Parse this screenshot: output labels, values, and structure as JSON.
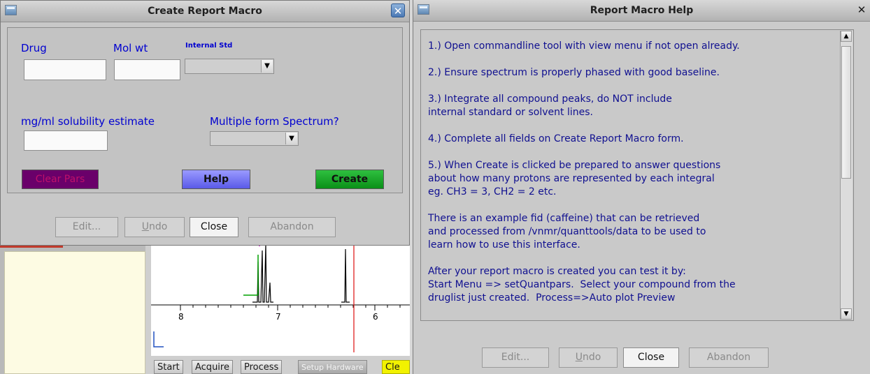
{
  "dialog1": {
    "title": "Create Report Macro",
    "close_glyph": "✕",
    "labels": {
      "drug": "Drug",
      "mol_wt": "Mol wt",
      "internal_std": "Internal Std",
      "solubility": "mg/ml solubility estimate",
      "multiple_form": "Multiple form Spectrum?"
    },
    "fields": {
      "drug_value": "",
      "mol_wt_value": "",
      "internal_std_value": "",
      "solubility_value": "",
      "multiple_form_value": ""
    },
    "buttons": {
      "clear_pars": "Clear Pars",
      "help": "Help",
      "create": "Create"
    },
    "footer": {
      "edit": "Edit...",
      "undo_u": "U",
      "undo_rest": "ndo",
      "close": "Close",
      "abandon": "Abandon"
    },
    "colors": {
      "clear_pars_bg": "#6a006a",
      "clear_pars_text": "#c0106a",
      "help_bg": "#6f6ff0",
      "create_bg": "#10a020"
    }
  },
  "dialog2": {
    "title": "Report Macro Help",
    "close_glyph": "✕",
    "paragraphs": [
      "1.) Open commandline tool with view menu if not open already.",
      "2.) Ensure spectrum is properly phased with good baseline.",
      "3.) Integrate all compound peaks, do NOT include\ninternal standard or solvent lines.",
      "4.) Complete all fields on Create Report Macro form.",
      "5.) When Create is clicked be prepared to answer questions\nabout how many protons are represented by each integral\neg. CH3 = 3, CH2 = 2 etc.",
      "There is an example fid (caffeine) that can be retrieved\nand processed from /vnmr/quanttools/data to be used to\nlearn how to use this interface.",
      "After your report macro is created you can test it by:\nStart Menu => setQuantpars.  Select your compound from the\ndruglist just created.  Process=>Auto plot Preview"
    ],
    "footer": {
      "edit": "Edit...",
      "undo_u": "U",
      "undo_rest": "ndo",
      "close": "Close",
      "abandon": "Abandon"
    }
  },
  "spectrum": {
    "axis_ticks": [
      "8",
      "7",
      "6"
    ]
  },
  "taskbar": {
    "tabs": [
      "Start",
      "Acquire",
      "Process",
      "Setup Hardware",
      "Cle"
    ]
  }
}
